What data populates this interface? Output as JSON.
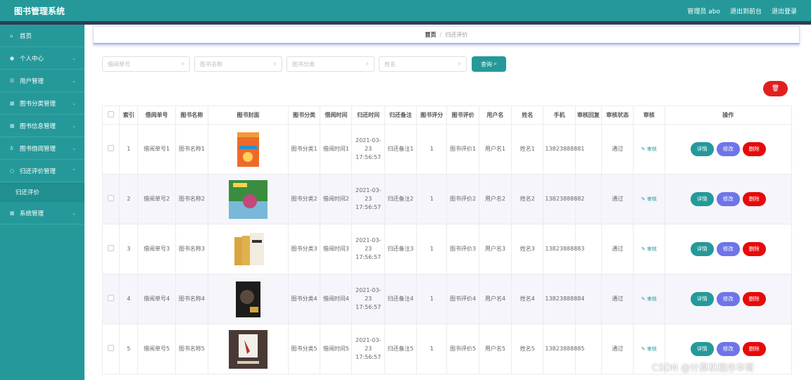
{
  "app": {
    "title": "图书管理系统",
    "user": "管理员 abo",
    "goto_frontend": "退出到前台",
    "logout": "退出登录"
  },
  "sidebar": {
    "items": [
      {
        "label": "首页",
        "icon": "home-icon",
        "chev": ""
      },
      {
        "label": "个人中心",
        "icon": "user-icon",
        "chev": "⌄"
      },
      {
        "label": "用户管理",
        "icon": "list-icon",
        "chev": "⌄"
      },
      {
        "label": "图书分类管理",
        "icon": "grid-icon",
        "chev": "⌄"
      },
      {
        "label": "图书信息管理",
        "icon": "grid-icon",
        "chev": "⌄"
      },
      {
        "label": "图书借阅管理",
        "icon": "pin-icon",
        "chev": "⌄"
      },
      {
        "label": "归还评价管理",
        "icon": "circle-icon",
        "chev": "⌃"
      }
    ],
    "subitem": "归还评价",
    "last": {
      "label": "系统管理",
      "icon": "grid-icon",
      "chev": "⌄"
    }
  },
  "breadcrumb": {
    "home": "首页",
    "current": "归还评价"
  },
  "search": {
    "f1": "借阅单号",
    "f2": "图书名称",
    "f3": "图书分类",
    "f4": "姓名",
    "button": "查询"
  },
  "table": {
    "headers": [
      "索引",
      "借阅单号",
      "图书名称",
      "图书封面",
      "图书分类",
      "借阅时间",
      "归还时间",
      "归还备注",
      "图书评分",
      "图书评价",
      "用户名",
      "姓名",
      "手机",
      "审核回复",
      "审核状态",
      "审核",
      "操作"
    ],
    "rows": [
      {
        "idx": "1",
        "no": "借阅单号1",
        "name": "图书名称1",
        "cat": "图书分类1",
        "borrow": "借阅时间1",
        "ret": "2021-03-23 17:56:57",
        "note": "归还备注1",
        "score": "1",
        "eval": "图书评价1",
        "user": "用户名1",
        "rname": "姓名1",
        "phone": "13823888881",
        "reply": "",
        "status": "通过",
        "audit": "审核"
      },
      {
        "idx": "2",
        "no": "借阅单号2",
        "name": "图书名称2",
        "cat": "图书分类2",
        "borrow": "借阅时间2",
        "ret": "2021-03-23 17:56:57",
        "note": "归还备注2",
        "score": "1",
        "eval": "图书评价2",
        "user": "用户名2",
        "rname": "姓名2",
        "phone": "13823888882",
        "reply": "",
        "status": "通过",
        "audit": "审核"
      },
      {
        "idx": "3",
        "no": "借阅单号3",
        "name": "图书名称3",
        "cat": "图书分类3",
        "borrow": "借阅时间3",
        "ret": "2021-03-23 17:56:57",
        "note": "归还备注3",
        "score": "1",
        "eval": "图书评价3",
        "user": "用户名3",
        "rname": "姓名3",
        "phone": "13823888883",
        "reply": "",
        "status": "通过",
        "audit": "审核"
      },
      {
        "idx": "4",
        "no": "借阅单号4",
        "name": "图书名称4",
        "cat": "图书分类4",
        "borrow": "借阅时间4",
        "ret": "2021-03-23 17:56:57",
        "note": "归还备注4",
        "score": "1",
        "eval": "图书评价4",
        "user": "用户名4",
        "rname": "姓名4",
        "phone": "13823888884",
        "reply": "",
        "status": "通过",
        "audit": "审核"
      },
      {
        "idx": "5",
        "no": "借阅单号5",
        "name": "图书名称5",
        "cat": "图书分类5",
        "borrow": "借阅时间5",
        "ret": "2021-03-23 17:56:57",
        "note": "归还备注5",
        "score": "1",
        "eval": "图书评价5",
        "user": "用户名5",
        "rname": "姓名5",
        "phone": "13823888885",
        "reply": "",
        "status": "通过",
        "audit": "审核"
      }
    ],
    "actions": {
      "detail": "详情",
      "edit": "修改",
      "delete": "删除"
    }
  },
  "colors": {
    "accent": "#25999a",
    "edit": "#6f74e8",
    "danger": "#e80a0a",
    "nav_dark": "#2e3d55"
  },
  "watermark": "CSDN @计算机程序华哥"
}
